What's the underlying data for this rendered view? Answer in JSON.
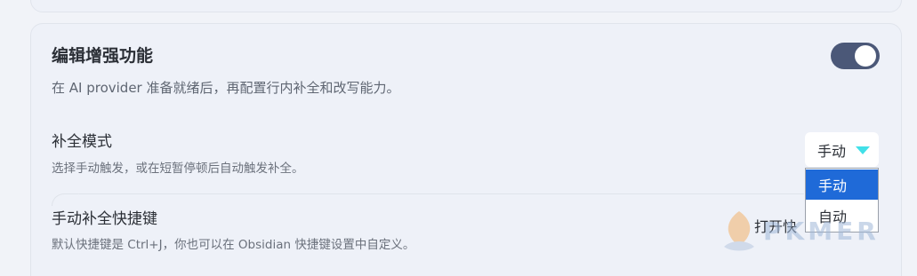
{
  "section": {
    "title": "编辑增强功能",
    "description": "在 AI provider 准备就绪后，再配置行内补全和改写能力。",
    "toggle_on": true
  },
  "completion_mode": {
    "title": "补全模式",
    "description": "选择手动触发，或在短暂停顿后自动触发补全。",
    "selected_value": "手动",
    "options": [
      "手动",
      "自动"
    ]
  },
  "manual_shortcut": {
    "title": "手动补全快捷键",
    "description": "默认快捷键是 Ctrl+J，你也可以在 Obsidian 快捷键设置中自定义。",
    "button_label": "打开快"
  },
  "watermark": {
    "text": "PKMER"
  },
  "colors": {
    "toggle_track": "#4b5878",
    "dropdown_arrow": "#41e0e8",
    "option_highlight": "#1f6ad8"
  }
}
